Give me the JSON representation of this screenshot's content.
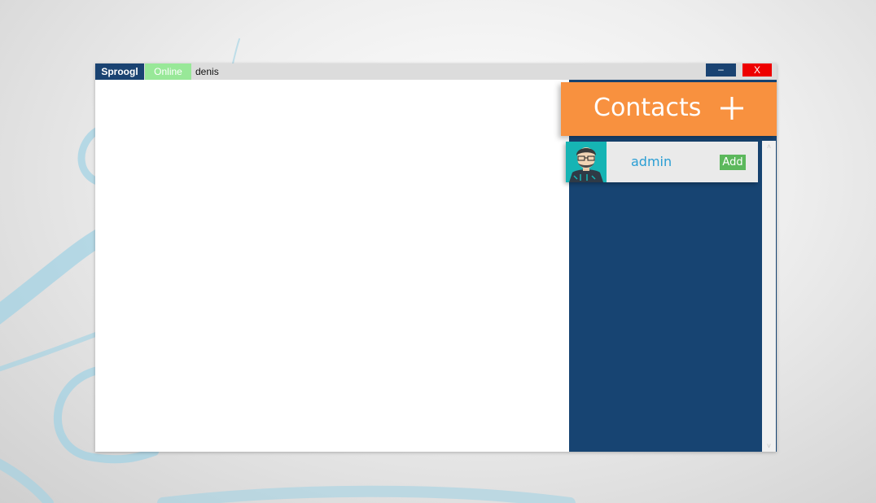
{
  "titlebar": {
    "app_name": "Sproogl",
    "status": "Online",
    "username": "denis",
    "minimize_label": "–",
    "close_label": "X"
  },
  "contacts": {
    "title": "Contacts",
    "add_icon": "plus-icon",
    "items": [
      {
        "name": "admin",
        "action_label": "Add",
        "avatar": "avatar-icon"
      }
    ]
  },
  "scrollbar": {
    "up": "˄",
    "down": "˅"
  },
  "colors": {
    "titlebar_dark": "#1a4372",
    "status_green": "#98e898",
    "close_red": "#ee0000",
    "sidebar": "#174472",
    "contacts_header": "#f8913f",
    "contact_name": "#2a9ed4",
    "add_button": "#5cb85c"
  }
}
